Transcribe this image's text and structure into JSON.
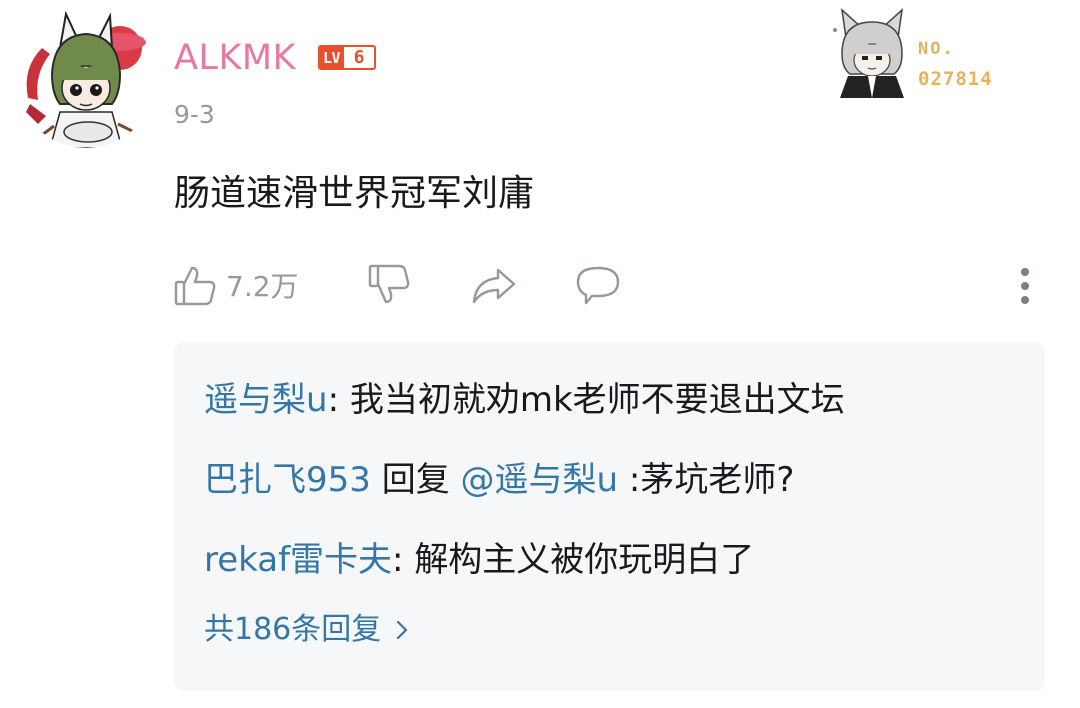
{
  "comment": {
    "user": {
      "name": "ALKMK",
      "level_prefix": "LV",
      "level_num": "6",
      "date": "9-3"
    },
    "fan_badge": {
      "label": "NO.",
      "number": "027814"
    },
    "text": "肠道速滑世界冠军刘庸",
    "actions": {
      "like_count": "7.2万"
    }
  },
  "replies": {
    "items": [
      {
        "user": "遥与梨u",
        "sep": ": ",
        "text": "我当初就劝mk老师不要退出文坛"
      },
      {
        "user": "巴扎飞953",
        "reply_word": " 回复 ",
        "mention": "@遥与梨u",
        "text": " :茅坑老师?"
      },
      {
        "user": "rekaf雷卡夫",
        "sep": ": ",
        "text": "解构主义被你玩明白了"
      }
    ],
    "view_all": "共186条回复"
  },
  "colors": {
    "username": "#e8799e",
    "level_badge": "#ea4f2c",
    "reply_link": "#3477a6",
    "muted": "#9499a0",
    "fan_badge_text": "#e5b458",
    "panel_bg": "#f6f7f8"
  },
  "icons": [
    "thumbs-up-icon",
    "thumbs-down-icon",
    "share-icon",
    "comment-bubble-icon",
    "more-vertical-icon",
    "chevron-right-icon"
  ]
}
